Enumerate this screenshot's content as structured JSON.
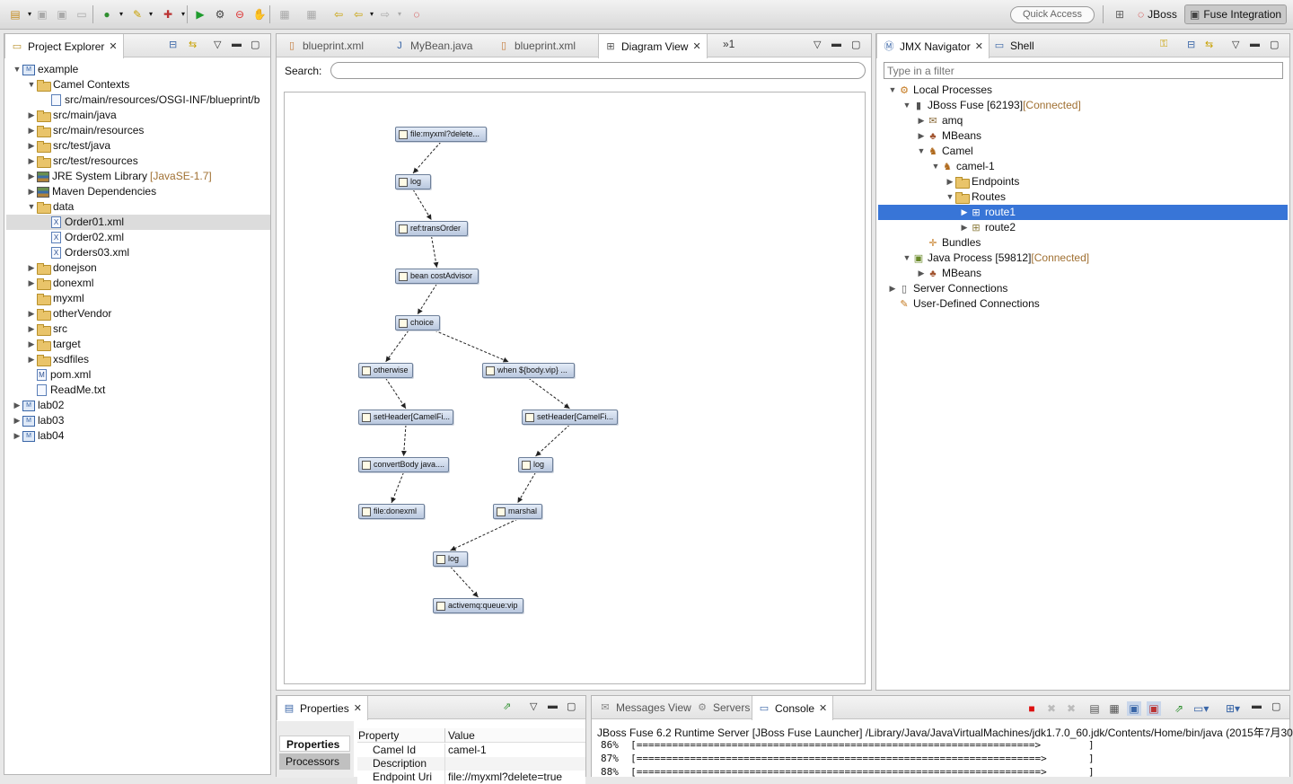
{
  "toolbar": {
    "quick_access": "Quick Access",
    "perspectives": [
      {
        "label": "JBoss"
      },
      {
        "label": "Fuse Integration"
      }
    ]
  },
  "project_explorer": {
    "title": "Project Explorer",
    "tree": [
      {
        "label": "example",
        "level": 0,
        "twisty": "open",
        "icon": "project"
      },
      {
        "label": "Camel Contexts",
        "level": 1,
        "twisty": "open",
        "icon": "folder"
      },
      {
        "label": "src/main/resources/OSGI-INF/blueprint/b",
        "level": 2,
        "twisty": "none",
        "icon": "file"
      },
      {
        "label": "src/main/java",
        "level": 1,
        "twisty": "closed",
        "icon": "folder"
      },
      {
        "label": "src/main/resources",
        "level": 1,
        "twisty": "closed",
        "icon": "folder"
      },
      {
        "label": "src/test/java",
        "level": 1,
        "twisty": "closed",
        "icon": "folder"
      },
      {
        "label": "src/test/resources",
        "level": 1,
        "twisty": "closed",
        "icon": "folder"
      },
      {
        "label": "JRE System Library",
        "suffix": "[JavaSE-1.7]",
        "level": 1,
        "twisty": "closed",
        "icon": "lib"
      },
      {
        "label": "Maven Dependencies",
        "level": 1,
        "twisty": "closed",
        "icon": "lib"
      },
      {
        "label": "data",
        "level": 1,
        "twisty": "open",
        "icon": "folder"
      },
      {
        "label": "Order01.xml",
        "level": 2,
        "twisty": "none",
        "icon": "xml",
        "selected": true
      },
      {
        "label": "Order02.xml",
        "level": 2,
        "twisty": "none",
        "icon": "xml"
      },
      {
        "label": "Orders03.xml",
        "level": 2,
        "twisty": "none",
        "icon": "xml"
      },
      {
        "label": "donejson",
        "level": 1,
        "twisty": "closed",
        "icon": "folder"
      },
      {
        "label": "donexml",
        "level": 1,
        "twisty": "closed",
        "icon": "folder"
      },
      {
        "label": "myxml",
        "level": 1,
        "twisty": "none",
        "icon": "folder"
      },
      {
        "label": "otherVendor",
        "level": 1,
        "twisty": "closed",
        "icon": "folder"
      },
      {
        "label": "src",
        "level": 1,
        "twisty": "closed",
        "icon": "folder"
      },
      {
        "label": "target",
        "level": 1,
        "twisty": "closed",
        "icon": "folder"
      },
      {
        "label": "xsdfiles",
        "level": 1,
        "twisty": "closed",
        "icon": "folder"
      },
      {
        "label": "pom.xml",
        "level": 1,
        "twisty": "none",
        "icon": "maven"
      },
      {
        "label": "ReadMe.txt",
        "level": 1,
        "twisty": "none",
        "icon": "file"
      },
      {
        "label": "lab02",
        "level": 0,
        "twisty": "closed",
        "icon": "project"
      },
      {
        "label": "lab03",
        "level": 0,
        "twisty": "closed",
        "icon": "project"
      },
      {
        "label": "lab04",
        "level": 0,
        "twisty": "closed",
        "icon": "project"
      }
    ]
  },
  "editor": {
    "tabs": [
      {
        "label": "blueprint.xml"
      },
      {
        "label": "MyBean.java"
      },
      {
        "label": "blueprint.xml"
      },
      {
        "label": "Diagram View",
        "active": true
      }
    ],
    "overflow": "»1",
    "search_label": "Search:",
    "diagram": {
      "nodes": [
        {
          "label": "file:myxml?delete..."
        },
        {
          "label": "log"
        },
        {
          "label": "ref:transOrder"
        },
        {
          "label": "bean costAdvisor"
        },
        {
          "label": "choice"
        },
        {
          "label": "otherwise"
        },
        {
          "label": "when ${body.vip} ..."
        },
        {
          "label": "setHeader[CamelFi..."
        },
        {
          "label": "setHeader[CamelFi..."
        },
        {
          "label": "convertBody java...."
        },
        {
          "label": "log"
        },
        {
          "label": "file:donexml"
        },
        {
          "label": "marshal"
        },
        {
          "label": "log"
        },
        {
          "label": "activemq:queue:vip"
        }
      ]
    }
  },
  "jmx": {
    "tabs": [
      {
        "label": "JMX Navigator",
        "active": true
      },
      {
        "label": "Shell"
      }
    ],
    "filter_placeholder": "Type in a filter",
    "tree": [
      {
        "label": "Local Processes",
        "level": 0,
        "twisty": "open",
        "icon": "gears"
      },
      {
        "label": "JBoss Fuse [62193]",
        "suffix": "[Connected]",
        "level": 1,
        "twisty": "open",
        "icon": "server"
      },
      {
        "label": "amq",
        "level": 2,
        "twisty": "closed",
        "icon": "amq"
      },
      {
        "label": "MBeans",
        "level": 2,
        "twisty": "closed",
        "icon": "beans"
      },
      {
        "label": "Camel",
        "level": 2,
        "twisty": "open",
        "icon": "camel"
      },
      {
        "label": "camel-1",
        "level": 3,
        "twisty": "open",
        "icon": "camel"
      },
      {
        "label": "Endpoints",
        "level": 4,
        "twisty": "closed",
        "icon": "folder"
      },
      {
        "label": "Routes",
        "level": 4,
        "twisty": "open",
        "icon": "folder"
      },
      {
        "label": "route1",
        "level": 5,
        "twisty": "closed",
        "icon": "route",
        "selected": true
      },
      {
        "label": "route2",
        "level": 5,
        "twisty": "closed",
        "icon": "route"
      },
      {
        "label": "Bundles",
        "level": 2,
        "twisty": "none",
        "icon": "bundle"
      },
      {
        "label": "Java Process [59812]",
        "suffix": "[Connected]",
        "level": 1,
        "twisty": "open",
        "icon": "jar"
      },
      {
        "label": "MBeans",
        "level": 2,
        "twisty": "closed",
        "icon": "beans"
      },
      {
        "label": "Server Connections",
        "level": 0,
        "twisty": "closed",
        "icon": "srv"
      },
      {
        "label": "User-Defined Connections",
        "level": 0,
        "twisty": "none",
        "icon": "pencil"
      }
    ]
  },
  "properties": {
    "title": "Properties",
    "side_tabs": [
      "Properties",
      "Processors"
    ],
    "columns": [
      "Property",
      "Value"
    ],
    "rows": [
      {
        "property": "Camel Id",
        "value": "camel-1"
      },
      {
        "property": "Description",
        "value": ""
      },
      {
        "property": "Endpoint Uri",
        "value": "file://myxml?delete=true"
      }
    ]
  },
  "console": {
    "tabs": [
      {
        "label": "Messages View"
      },
      {
        "label": "Servers"
      },
      {
        "label": "Console",
        "active": true
      }
    ],
    "header": "JBoss Fuse 6.2 Runtime Server [JBoss Fuse Launcher] /Library/Java/JavaVirtualMachines/jdk1.7.0_60.jdk/Contents/Home/bin/java (2015年7月30",
    "lines": [
      "86%  [===================================================================>        ]",
      "87%  [====================================================================>       ]",
      "88%  [====================================================================>       ]"
    ]
  }
}
